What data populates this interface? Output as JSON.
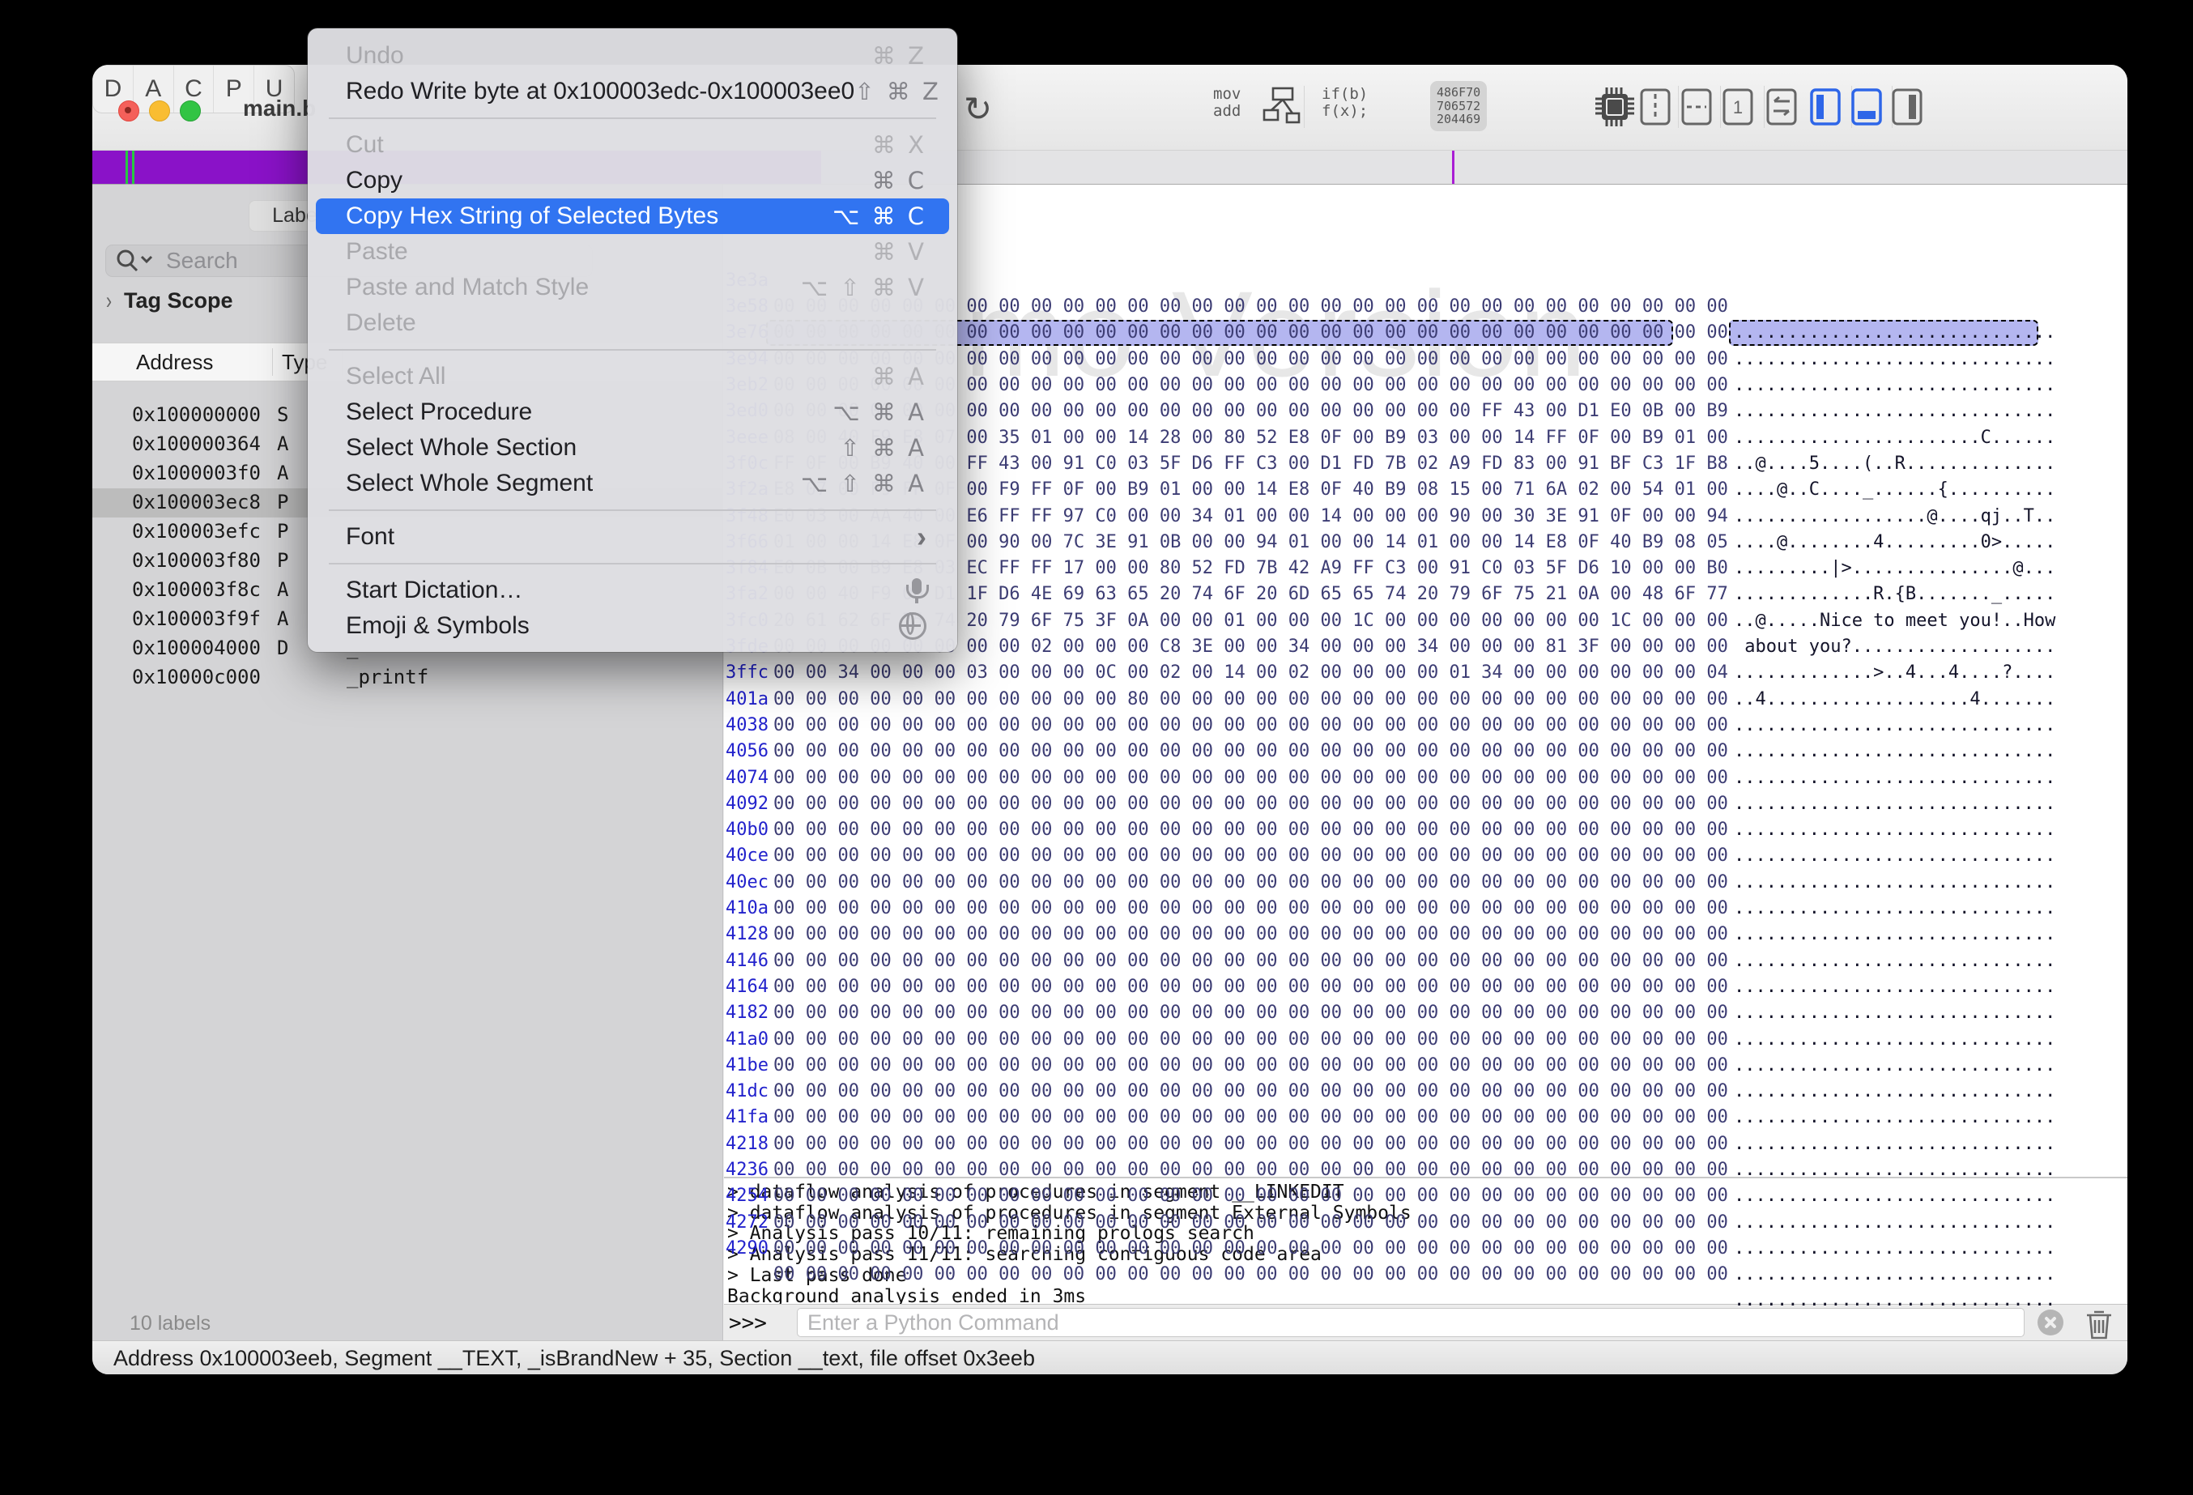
{
  "window": {
    "title": "main.b"
  },
  "toolbar": {
    "segments": [
      "D",
      "A",
      "C",
      "P",
      "U"
    ],
    "movadd": [
      "mov",
      "add"
    ],
    "iffx": [
      "if(b)",
      "f(x);"
    ],
    "hexbadge": [
      "486F70",
      "706572",
      "204469"
    ]
  },
  "context_menu": {
    "items": [
      {
        "label": "Undo",
        "shortcut": "⌘ Z",
        "cls": "disabled"
      },
      {
        "label": "Redo Write byte at 0x100003edc-0x100003ee0",
        "shortcut": "⇧ ⌘ Z"
      },
      {
        "cls": "sep"
      },
      {
        "label": "Cut",
        "shortcut": "⌘ X",
        "cls": "disabled"
      },
      {
        "label": "Copy",
        "shortcut": "⌘ C"
      },
      {
        "label": "Copy Hex String of Selected Bytes",
        "shortcut": "⌥ ⌘ C",
        "cls": "highlighted"
      },
      {
        "label": "Paste",
        "shortcut": "⌘ V",
        "cls": "disabled"
      },
      {
        "label": "Paste and Match Style",
        "shortcut": "⌥ ⇧ ⌘ V",
        "cls": "disabled"
      },
      {
        "label": "Delete",
        "shortcut": "",
        "cls": "disabled"
      },
      {
        "cls": "sep"
      },
      {
        "label": "Select All",
        "shortcut": "⌘ A",
        "cls": "disabled"
      },
      {
        "label": "Select Procedure",
        "shortcut": "⌥ ⌘ A"
      },
      {
        "label": "Select Whole Section",
        "shortcut": "⇧ ⌘ A"
      },
      {
        "label": "Select Whole Segment",
        "shortcut": "⌥ ⇧ ⌘ A"
      },
      {
        "cls": "sep"
      },
      {
        "label": "Font",
        "shortcut": "",
        "cls": "chev"
      },
      {
        "cls": "sep"
      },
      {
        "label": "Start Dictation…",
        "shortcut": "",
        "icon": "mic-icon"
      },
      {
        "label": "Emoji & Symbols",
        "shortcut": "",
        "icon": "globe-icon"
      }
    ]
  },
  "sidebar": {
    "labels_button": "Labels",
    "search_placeholder": "Search",
    "tag_scope": "Tag Scope",
    "columns": {
      "address": "Address",
      "type": "Type"
    },
    "rows": [
      {
        "addr": "0x100000000",
        "type": "S",
        "name": ""
      },
      {
        "addr": "0x100000364",
        "type": "A",
        "name": ""
      },
      {
        "addr": "0x1000003f0",
        "type": "A",
        "name": ""
      },
      {
        "addr": "0x100003ec8",
        "type": "P",
        "name": "",
        "selected": true
      },
      {
        "addr": "0x100003efc",
        "type": "P",
        "name": ""
      },
      {
        "addr": "0x100003f80",
        "type": "P",
        "name": ""
      },
      {
        "addr": "0x100003f8c",
        "type": "A",
        "name": ""
      },
      {
        "addr": "0x100003f9f",
        "type": "A",
        "name": ""
      },
      {
        "addr": "0x100004000",
        "type": "D",
        "name": "_"
      },
      {
        "addr": "0x10000c000",
        "type": "",
        "name": "_printf"
      }
    ],
    "footer": "10 labels"
  },
  "hex_view": {
    "watermark": "Demo Version",
    "rows": [
      {
        "addr": "3e3a",
        "bytes": "00 00 00 00 00 00 00 00 00 00 00 00 00 00 00 00 00 00 00 00 00 00 00 00 00 00 00 00 00 00",
        "ascii": ".............................."
      },
      {
        "addr": "3e58",
        "bytes": "00 00 00 00 00 00 00 00 00 00 00 00 00 00 00 00 00 00 00 00 00 00 00 00 00 00 00 00 00 00",
        "ascii": ".............................."
      },
      {
        "addr": "3e76",
        "bytes": "00 00 00 00 00 00 00 00 00 00 00 00 00 00 00 00 00 00 00 00 00 00 00 00 00 00 00 00 00 00",
        "ascii": ".............................."
      },
      {
        "addr": "3e94",
        "bytes": "00 00 00 00 00 00 00 00 00 00 00 00 00 00 00 00 00 00 00 00 00 00 00 00 00 00 00 00 00 00",
        "ascii": ".............................."
      },
      {
        "addr": "3eb2",
        "bytes": "00 00 00 00 00 00 00 00 00 00 00 00 00 00 00 00 00 00 00 00 00 00 FF 43 00 D1 E0 0B 00 B9",
        "ascii": ".......................C......"
      },
      {
        "addr": "3ed0",
        "bytes": "08 00 40 F9 E8 07 00 35 01 00 00 14 28 00 80 52 E8 0F 00 B9 03 00 00 14 FF 0F 00 B9 01 00",
        "ascii": "..@....5....(..R..............",
        "selected": true
      },
      {
        "addr": "3eee",
        "bytes": "FF 0F 00 B9 40 00 FF 43 00 91 C0 03 5F D6 FF C3 00 D1 FD 7B 02 A9 FD 83 00 91 BF C3 1F B8",
        "ascii": "....@..C...._......{.........."
      },
      {
        "addr": "3f0c",
        "bytes": "E8 07 00 F9 FF 0F 00 F9 FF 0F 00 B9 01 00 00 14 E8 0F 40 B9 08 15 00 71 6A 02 00 54 01 00",
        "ascii": "..................@....qj..T.."
      },
      {
        "addr": "3f2a",
        "bytes": "E0 03 00 AA 40 00 E6 FF FF 97 C0 00 00 34 01 00 00 14 00 00 00 90 00 30 3E 91 0F 00 00 94",
        "ascii": "....@........4.........0>....."
      },
      {
        "addr": "3f48",
        "bytes": "01 00 00 14 E8 0F 00 90 00 7C 3E 91 0B 00 00 94 01 00 00 14 01 00 00 14 E8 0F 40 B9 08 05",
        "ascii": ".........|>...............@..."
      },
      {
        "addr": "3f66",
        "bytes": "E0 0B 00 B9 E8 03 EC FF FF 17 00 00 80 52 FD 7B 42 A9 FF C3 00 91 C0 03 5F D6 10 00 00 B0",
        "ascii": ".............R.{B......._....."
      },
      {
        "addr": "3f84",
        "bytes": "00 00 40 F9 00 D1 1F D6 4E 69 63 65 20 74 6F 20 6D 65 65 74 20 79 6F 75 21 0A 00 48 6F 77",
        "ascii": "..@.....Nice to meet you!..How"
      },
      {
        "addr": "3fa2",
        "bytes": "20 61 62 6F 75 74 20 79 6F 75 3F 0A 00 00 01 00 00 00 1C 00 00 00 00 00 00 00 1C 00 00 00",
        "ascii": " about you?..................."
      },
      {
        "addr": "3fc0",
        "bytes": "00 00 00 00 00 00 00 00 02 00 00 00 C8 3E 00 00 34 00 00 00 34 00 00 00 81 3F 00 00 00 00",
        "ascii": ".............>..4...4....?...."
      },
      {
        "addr": "3fde",
        "bytes": "00 00 34 00 00 00 03 00 00 00 0C 00 02 00 14 00 02 00 00 00 00 01 34 00 00 00 00 00 00 04",
        "ascii": "..4...................4......."
      },
      {
        "addr": "3ffc",
        "bytes": "00 00 00 00 00 00 00 00 00 00 00 80 00 00 00 00 00 00 00 00 00 00 00 00 00 00 00 00 00 00",
        "ascii": ".............................."
      },
      {
        "addr": "401a",
        "bytes": "00 00 00 00 00 00 00 00 00 00 00 00 00 00 00 00 00 00 00 00 00 00 00 00 00 00 00 00 00 00",
        "ascii": ".............................."
      },
      {
        "addr": "4038",
        "bytes": "00 00 00 00 00 00 00 00 00 00 00 00 00 00 00 00 00 00 00 00 00 00 00 00 00 00 00 00 00 00",
        "ascii": ".............................."
      },
      {
        "addr": "4056",
        "bytes": "00 00 00 00 00 00 00 00 00 00 00 00 00 00 00 00 00 00 00 00 00 00 00 00 00 00 00 00 00 00",
        "ascii": ".............................."
      },
      {
        "addr": "4074",
        "bytes": "00 00 00 00 00 00 00 00 00 00 00 00 00 00 00 00 00 00 00 00 00 00 00 00 00 00 00 00 00 00",
        "ascii": ".............................."
      },
      {
        "addr": "4092",
        "bytes": "00 00 00 00 00 00 00 00 00 00 00 00 00 00 00 00 00 00 00 00 00 00 00 00 00 00 00 00 00 00",
        "ascii": ".............................."
      },
      {
        "addr": "40b0",
        "bytes": "00 00 00 00 00 00 00 00 00 00 00 00 00 00 00 00 00 00 00 00 00 00 00 00 00 00 00 00 00 00",
        "ascii": ".............................."
      },
      {
        "addr": "40ce",
        "bytes": "00 00 00 00 00 00 00 00 00 00 00 00 00 00 00 00 00 00 00 00 00 00 00 00 00 00 00 00 00 00",
        "ascii": ".............................."
      },
      {
        "addr": "40ec",
        "bytes": "00 00 00 00 00 00 00 00 00 00 00 00 00 00 00 00 00 00 00 00 00 00 00 00 00 00 00 00 00 00",
        "ascii": ".............................."
      },
      {
        "addr": "410a",
        "bytes": "00 00 00 00 00 00 00 00 00 00 00 00 00 00 00 00 00 00 00 00 00 00 00 00 00 00 00 00 00 00",
        "ascii": ".............................."
      },
      {
        "addr": "4128",
        "bytes": "00 00 00 00 00 00 00 00 00 00 00 00 00 00 00 00 00 00 00 00 00 00 00 00 00 00 00 00 00 00",
        "ascii": ".............................."
      },
      {
        "addr": "4146",
        "bytes": "00 00 00 00 00 00 00 00 00 00 00 00 00 00 00 00 00 00 00 00 00 00 00 00 00 00 00 00 00 00",
        "ascii": ".............................."
      },
      {
        "addr": "4164",
        "bytes": "00 00 00 00 00 00 00 00 00 00 00 00 00 00 00 00 00 00 00 00 00 00 00 00 00 00 00 00 00 00",
        "ascii": ".............................."
      },
      {
        "addr": "4182",
        "bytes": "00 00 00 00 00 00 00 00 00 00 00 00 00 00 00 00 00 00 00 00 00 00 00 00 00 00 00 00 00 00",
        "ascii": ".............................."
      },
      {
        "addr": "41a0",
        "bytes": "00 00 00 00 00 00 00 00 00 00 00 00 00 00 00 00 00 00 00 00 00 00 00 00 00 00 00 00 00 00",
        "ascii": ".............................."
      },
      {
        "addr": "41be",
        "bytes": "00 00 00 00 00 00 00 00 00 00 00 00 00 00 00 00 00 00 00 00 00 00 00 00 00 00 00 00 00 00",
        "ascii": ".............................."
      },
      {
        "addr": "41dc",
        "bytes": "00 00 00 00 00 00 00 00 00 00 00 00 00 00 00 00 00 00 00 00 00 00 00 00 00 00 00 00 00 00",
        "ascii": ".............................."
      },
      {
        "addr": "41fa",
        "bytes": "00 00 00 00 00 00 00 00 00 00 00 00 00 00 00 00 00 00 00 00 00 00 00 00 00 00 00 00 00 00",
        "ascii": ".............................."
      },
      {
        "addr": "4218",
        "bytes": "00 00 00 00 00 00 00 00 00 00 00 00 00 00 00 00 00 00 00 00 00 00 00 00 00 00 00 00 00 00",
        "ascii": ".............................."
      },
      {
        "addr": "4236",
        "bytes": "00 00 00 00 00 00 00 00 00 00 00 00 00 00 00 00 00 00 00 00 00 00 00 00 00 00 00 00 00 00",
        "ascii": ".............................."
      },
      {
        "addr": "4254",
        "bytes": "00 00 00 00 00 00 00 00 00 00 00 00 00 00 00 00 00 00 00 00 00 00 00 00 00 00 00 00 00 00",
        "ascii": ".............................."
      },
      {
        "addr": "4272",
        "bytes": "00 00 00 00 00 00 00 00 00 00 00 00 00 00 00 00 00 00 00 00 00 00 00 00 00 00 00 00 00 00",
        "ascii": ".............................."
      },
      {
        "addr": "4290",
        "bytes": "00 00 00 00 00 00 00 00 00 00 00 00 00 00 00 00 00 00 00 00 00 00 00 00 00 00 00 00 00 00",
        "ascii": ".............................."
      }
    ]
  },
  "console": {
    "lines": [
      "> dataflow analysis of procedures in segment __LINKEDIT",
      "> dataflow analysis of procedures in segment External Symbols",
      "> Analysis pass 10/11: remaining prologs search",
      "> Analysis pass 11/11: searching contiguous code area",
      "> Last pass done",
      "Background analysis ended in 3ms"
    ],
    "prompt": ">>>",
    "input_placeholder": "Enter a Python Command"
  },
  "status_bar": {
    "text": "Address 0x100003eeb, Segment __TEXT, _isBrandNew + 35, Section __text, file offset 0x3eeb"
  }
}
